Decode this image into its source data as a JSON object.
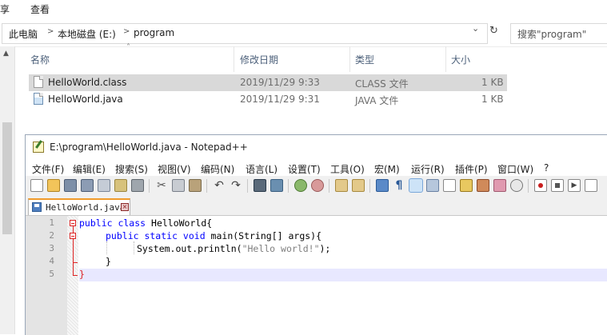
{
  "explorer": {
    "ribbon": [
      "享",
      "查看"
    ],
    "breadcrumb": [
      "此电脑",
      "本地磁盘 (E:)",
      "program"
    ],
    "search_placeholder": "搜索\"program\"",
    "columns": [
      "名称",
      "修改日期",
      "类型",
      "大小"
    ],
    "files": [
      {
        "name": "HelloWorld.class",
        "date": "2019/11/29 9:33",
        "type": "CLASS 文件",
        "size": "1 KB",
        "selected": true
      },
      {
        "name": "HelloWorld.java",
        "date": "2019/11/29 9:31",
        "type": "JAVA 文件",
        "size": "1 KB",
        "selected": false
      }
    ]
  },
  "notepad": {
    "title": "E:\\program\\HelloWorld.java - Notepad++",
    "menu": [
      "文件(F)",
      "编辑(E)",
      "搜索(S)",
      "视图(V)",
      "编码(N)",
      "语言(L)",
      "设置(T)",
      "工具(O)",
      "宏(M)",
      "运行(R)",
      "插件(P)",
      "窗口(W)",
      "?"
    ],
    "tab_label": "HelloWorld.java",
    "line_numbers": [
      "1",
      "2",
      "3",
      "4",
      "5"
    ],
    "code": {
      "l1_kw": "public class",
      "l1_txt": " HelloWorld{",
      "l2_kw": "public static void",
      "l2_txt": " main(String[] args){",
      "l3_a": "System.out.println(",
      "l3_str": "\"Hello world!\"",
      "l3_b": ");",
      "l4": "}",
      "l5": "}"
    },
    "colors": {
      "keyword": "#0000ff",
      "string": "#808080",
      "fold": "#dd2222",
      "current_line": "#e8e8ff",
      "tab_accent": "#f09b2b"
    }
  }
}
